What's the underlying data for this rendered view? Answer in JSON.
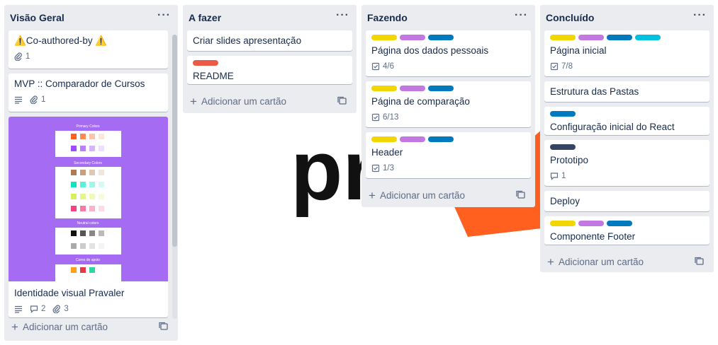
{
  "colors": {
    "yellow": "#f2d600",
    "purple": "#c377e0",
    "blue": "#0079bf",
    "sky": "#00c2e0",
    "red": "#eb5a46",
    "navy": "#344563",
    "orange_bg": "#ff5f1f",
    "cover": "#a56bf2"
  },
  "lists": [
    {
      "title": "Visão Geral",
      "menu": "···",
      "add_card": "Adicionar um cartão",
      "cards": [
        {
          "title": "⚠️Co-authored-by ⚠️",
          "attachments": "1"
        },
        {
          "title": "MVP :: Comparador de Cursos",
          "attachments": "1",
          "has_description": true
        },
        {
          "title": "Identidade visual Pravaler",
          "comments": "2",
          "attachments": "3",
          "cover_sections": [
            "Primary Colors",
            "Secondary Colors",
            "Neutral colors",
            "Cores de apoio"
          ]
        }
      ]
    },
    {
      "title": "A fazer",
      "menu": "···",
      "add_card": "Adicionar um cartão",
      "cards": [
        {
          "title": "Criar slides apresentação"
        },
        {
          "title": "README",
          "labels": [
            "red"
          ]
        }
      ]
    },
    {
      "title": "Fazendo",
      "menu": "···",
      "add_card": "Adicionar um cartão",
      "cards": [
        {
          "title": "Página dos dados pessoais",
          "labels": [
            "yellow",
            "purple",
            "blue"
          ],
          "checklist": "4/6"
        },
        {
          "title": "Página de comparação",
          "labels": [
            "yellow",
            "purple",
            "blue"
          ],
          "checklist": "6/13"
        },
        {
          "title": "Header",
          "labels": [
            "yellow",
            "purple",
            "blue"
          ],
          "checklist": "1/3"
        }
      ]
    },
    {
      "title": "Concluído",
      "menu": "···",
      "add_card": "Adicionar um cartão",
      "cards": [
        {
          "title": "Página inicial",
          "labels": [
            "yellow",
            "purple",
            "blue",
            "sky"
          ],
          "checklist": "7/8"
        },
        {
          "title": "Estrutura das Pastas"
        },
        {
          "title": "Configuração inicial do React",
          "labels": [
            "blue"
          ]
        },
        {
          "title": "Prototipo",
          "labels": [
            "navy"
          ],
          "comments": "1"
        },
        {
          "title": "Deploy"
        },
        {
          "title": "Componente Footer",
          "labels": [
            "yellow",
            "purple",
            "blue"
          ]
        }
      ]
    }
  ]
}
